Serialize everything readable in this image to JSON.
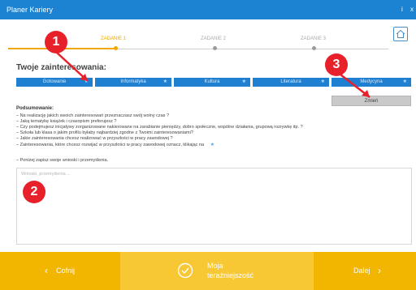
{
  "window": {
    "title": "Planer Kariery",
    "info_label": "i",
    "close_label": "x"
  },
  "steps": [
    {
      "label": "ZADANIE 1",
      "active": true
    },
    {
      "label": "ZADANIE 2",
      "active": false
    },
    {
      "label": "ZADANIE 3",
      "active": false
    }
  ],
  "interests": {
    "heading": "Twoje zainteresowania:",
    "items": [
      {
        "label": "Gotowanie"
      },
      {
        "label": "Informatyka"
      },
      {
        "label": "Kultura"
      },
      {
        "label": "Literatura"
      },
      {
        "label": "Medycyna"
      }
    ],
    "change_label": "Zmień"
  },
  "summary": {
    "title": "Podsumowanie:",
    "lines": [
      "– Na realizację jakich swoich zainteresowań przeznaczasz swój wolny czas ?",
      "– Jaką tematykę książek i czasopism preferujesz ?",
      "– Czy podejmujesz inicjatywy zorganizowane nakierowane na zarabianie pieniędzy, dobro społeczne, wspólne działania, grupową rozrywkę itp. ?",
      "– Szkoła lub klasa o jakim profilu byłaby najbardziej zgodne z Twoimi zainteresowaniami?",
      "– Jakie zainteresowania chcesz realizować w przyszłości w pracy zawodowej ?",
      "– Zainteresowania, które chcesz rozwijać w przyszłości w pracy zawodowej oznacz, klikając na"
    ],
    "last_line": "– Poniżej zapisz swoje wnioski i przemyślenia."
  },
  "notes": {
    "placeholder": "Wnioski, przemyślenia ..."
  },
  "footer": {
    "back_label": "Cofnij",
    "center_label_1": "Moja",
    "center_label_2": "teraźniejszość",
    "next_label": "Dalej"
  },
  "annotations": [
    "1",
    "2",
    "3"
  ]
}
